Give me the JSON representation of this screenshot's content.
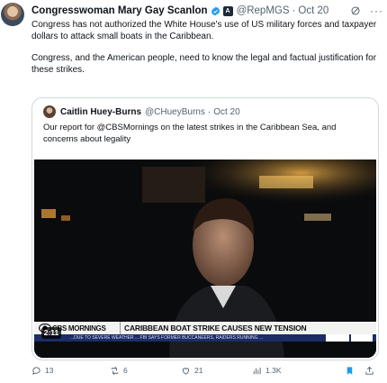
{
  "post": {
    "author_name": "Congresswoman Mary Gay Scanlon",
    "gov_badge": "A",
    "handle": "@RepMGS",
    "separator": "·",
    "date": "Oct 20",
    "more": "···",
    "paragraph_1": "Congress has not authorized the White House's use of US military forces and taxpayer dollars to attack small boats in the Caribbean.",
    "paragraph_2": "Congress, and the American people, need to know the legal and factual justification for these strikes."
  },
  "quote": {
    "author_name": "Caitlin Huey-Burns",
    "handle": "@CHueyBurns",
    "separator": "·",
    "date": "Oct 20",
    "text": "Our report for @CBSMornings on the latest strikes in the Caribbean Sea, and concerns about legality"
  },
  "video": {
    "network_logo": "CBS MORNINGS",
    "headline": "CARIBBEAN BOAT STRIKE CAUSES NEW TENSION",
    "ticker": "...DUE TO SEVERE WEATHER ... FBI SAYS FORMER BUCCANEERS, RAIDERS RUNNING ...",
    "duration": "2:11"
  },
  "actions": {
    "replies": "13",
    "reposts": "6",
    "likes": "21",
    "views": "1.3K"
  },
  "colors": {
    "verified": "#1d9bf0",
    "secondary_text": "#536471",
    "bookmark": "#1d9bf0"
  }
}
